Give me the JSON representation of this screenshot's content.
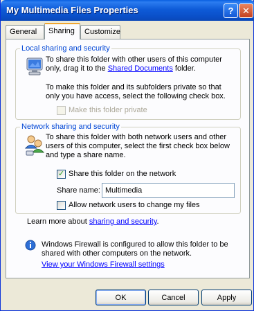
{
  "window": {
    "title": "My Multimedia Files Properties",
    "help_glyph": "?",
    "close_glyph": "✕"
  },
  "tabs": [
    {
      "label": "General"
    },
    {
      "label": "Sharing"
    },
    {
      "label": "Customize"
    }
  ],
  "local_sharing": {
    "legend": "Local sharing and security",
    "text_prefix": "To share this folder with other users of this computer only, drag it to the ",
    "link": "Shared Documents",
    "text_suffix": " folder.",
    "private_text": "To make this folder and its subfolders private so that only you have access, select the following check box.",
    "private_checkbox_label": "Make this folder private",
    "private_checked": false
  },
  "network_sharing": {
    "legend": "Network sharing and security",
    "text": "To share this folder with both network users and other users of this computer, select the first check box below and type a share name.",
    "share_checkbox_label": "Share this folder on the network",
    "share_checked": true,
    "share_name_label": "Share name:",
    "share_name_value": "Multimedia",
    "allow_change_label": "Allow network users to change my files",
    "allow_change_checked": false,
    "learn_prefix": "Learn more about ",
    "learn_link": "sharing and security",
    "learn_suffix": "."
  },
  "firewall": {
    "text": "Windows Firewall is configured to allow this folder to be shared with other computers on the network.",
    "link": "View your Windows Firewall settings"
  },
  "buttons": {
    "ok": "OK",
    "cancel": "Cancel",
    "apply": "Apply"
  },
  "colors": {
    "title_bar": "#0a4fc8",
    "legend_text": "#0046d5",
    "link": "#0000ff",
    "checkmark": "#21a121"
  }
}
